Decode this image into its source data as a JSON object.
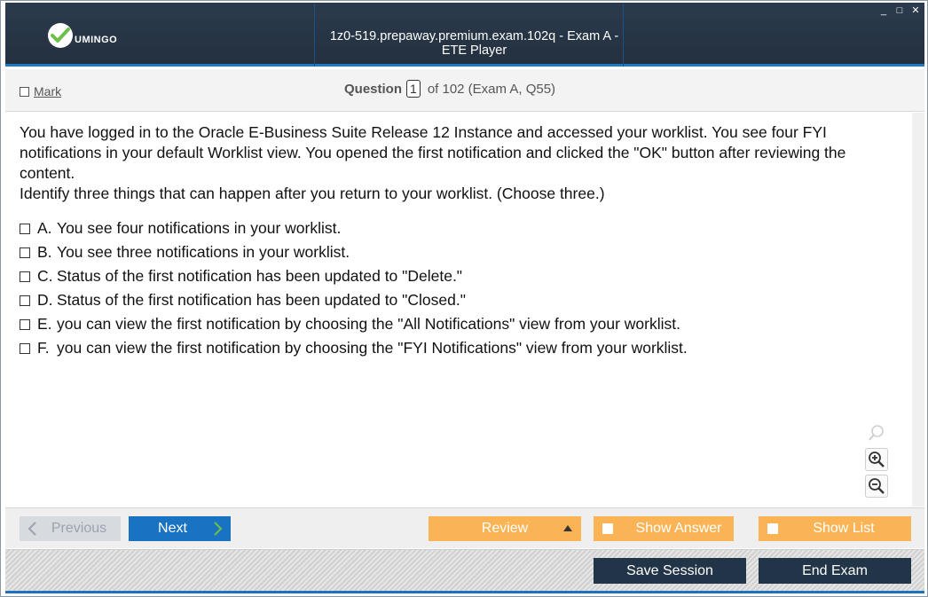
{
  "app": {
    "logo_text": "UMINGO",
    "window_title": "1z0-519.prepaway.premium.exam.102q - Exam A - ETE Player",
    "controls": {
      "minimize": "_",
      "maximize": "□",
      "close": "✕"
    }
  },
  "header": {
    "mark_label": "Mark",
    "question_label": "Question",
    "question_number": "1",
    "question_total": "of 102 (Exam A, Q55)"
  },
  "question": {
    "text_line1": "You have logged in to the Oracle E-Business Suite Release 12 Instance and accessed your worklist. You see four FYI notifications in your default Worklist view. You opened the first notification and clicked the \"OK\" button after reviewing the content.",
    "text_line2": "Identify three things that can happen after you return to your worklist. (Choose three.)",
    "options": [
      {
        "letter": "A.",
        "text": "You see four notifications in your worklist."
      },
      {
        "letter": "B.",
        "text": "You see three notifications in your worklist."
      },
      {
        "letter": "C.",
        "text": "Status of the first notification has been updated to \"Delete.\""
      },
      {
        "letter": "D.",
        "text": "Status of the first notification has been updated to \"Closed.\""
      },
      {
        "letter": "E.",
        "text": "you can view the first notification by choosing the \"All Notifications\" view from your worklist."
      },
      {
        "letter": "F.",
        "text": "you can view the first notification by choosing the \"FYI Notifications\" view from your worklist."
      }
    ]
  },
  "navigation": {
    "previous_label": "Previous",
    "next_label": "Next",
    "review_label": "Review",
    "show_answer_label": "Show Answer",
    "show_list_label": "Show List"
  },
  "footer": {
    "save_label": "Save Session",
    "end_label": "End Exam"
  },
  "colors": {
    "titlebar": "#23303f",
    "accent_blue": "#1a73c2",
    "orange": "#fbb455",
    "dark_button": "#223447",
    "logo_green": "#6cc04a"
  }
}
